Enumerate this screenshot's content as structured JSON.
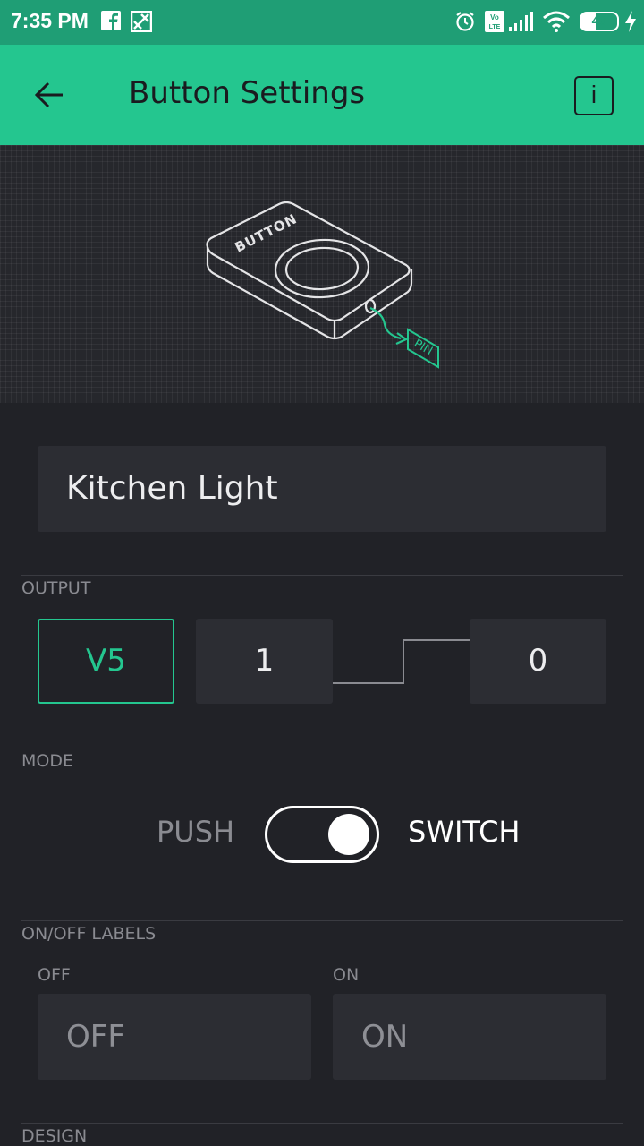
{
  "status_bar": {
    "time": "7:35 PM",
    "battery": "40",
    "icons": [
      "facebook-icon",
      "app-notification-icon",
      "alarm-icon",
      "volte-icon",
      "signal-icon",
      "wifi-icon",
      "battery-icon",
      "charging-icon"
    ]
  },
  "app_bar": {
    "title": "Button Settings",
    "back_icon": "arrow-left-icon",
    "info_label": "i"
  },
  "illustration": {
    "device_label": "BUTTON",
    "pin_label": "PIN"
  },
  "widget": {
    "name": "Kitchen Light"
  },
  "output": {
    "label": "OUTPUT",
    "pin": "V5",
    "value_low": "1",
    "value_high": "0"
  },
  "mode": {
    "label": "MODE",
    "left": "PUSH",
    "right": "SWITCH",
    "selected": "SWITCH"
  },
  "labels": {
    "section_label": "ON/OFF LABELS",
    "off_caption": "OFF",
    "off_value": "OFF",
    "on_caption": "ON",
    "on_value": "ON"
  },
  "design": {
    "label": "DESIGN"
  },
  "colors": {
    "accent": "#24c68f",
    "background": "#212227",
    "field": "#2c2d33"
  }
}
